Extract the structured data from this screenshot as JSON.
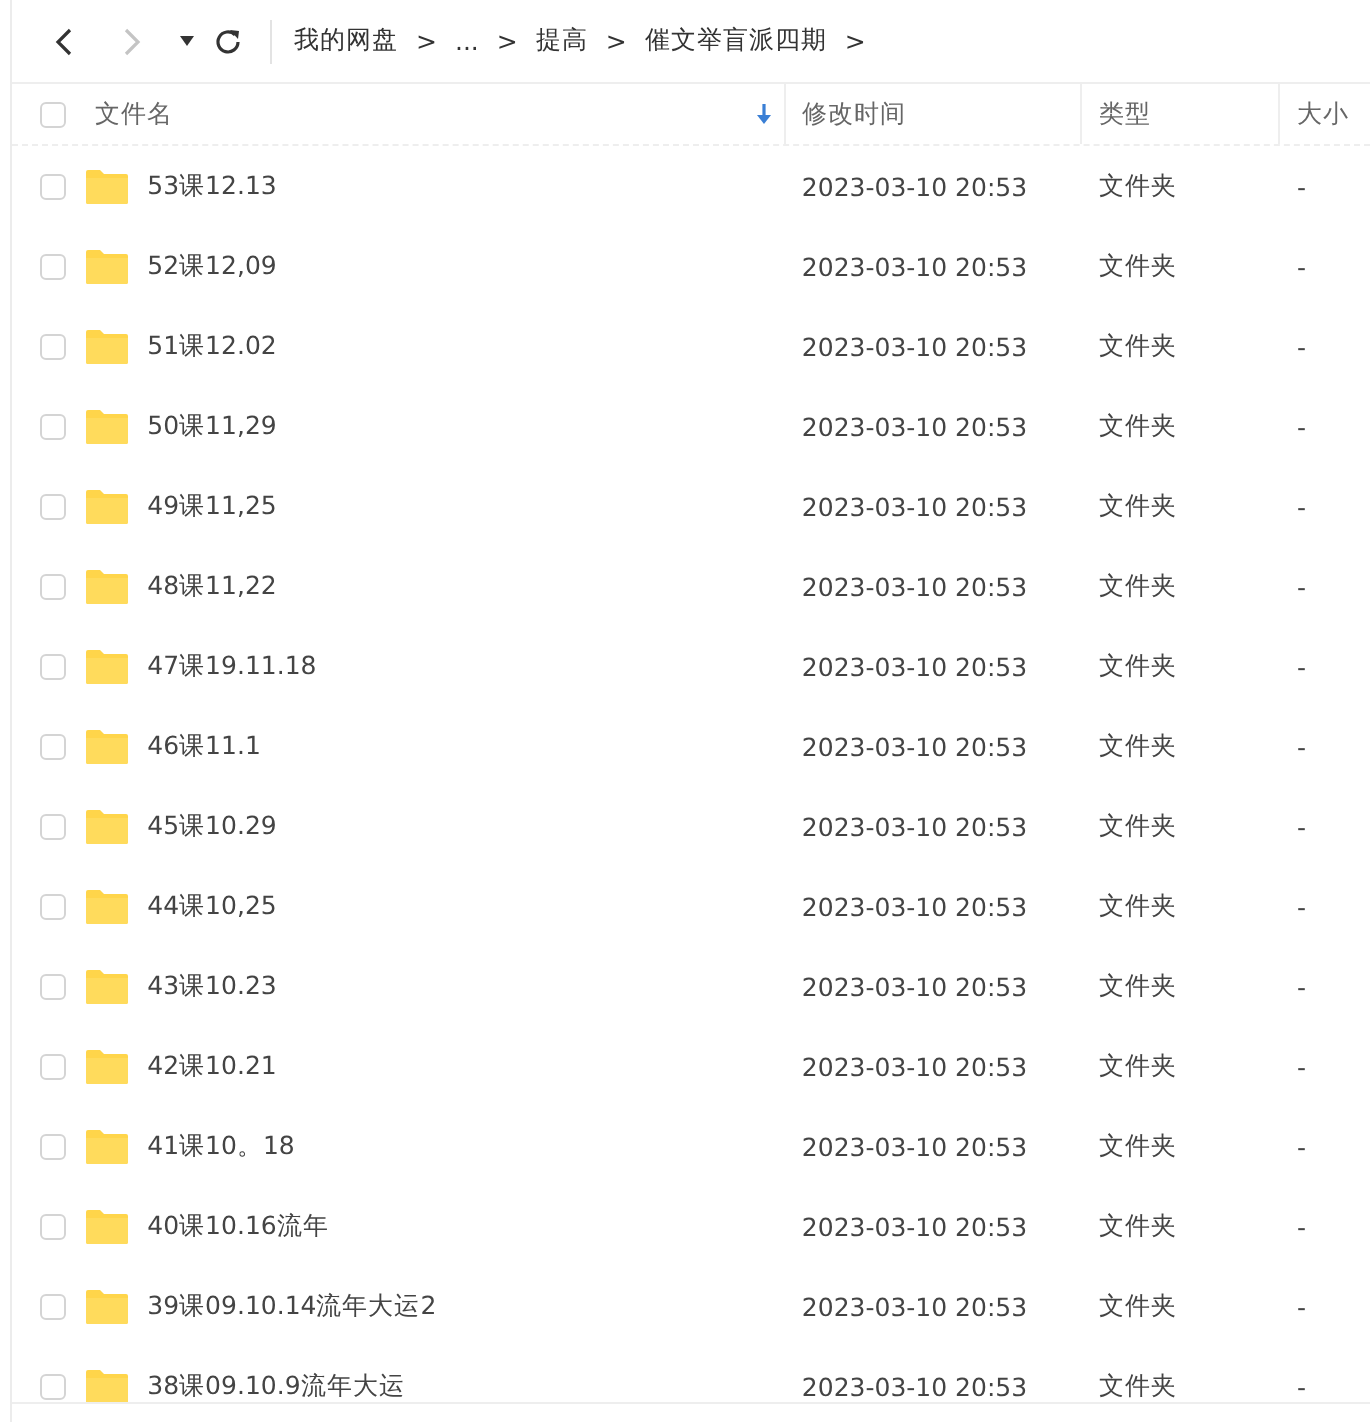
{
  "nav": {
    "back": {
      "disabled": false
    },
    "forward": {
      "disabled": true
    }
  },
  "breadcrumbs": [
    {
      "label": "我的网盘"
    },
    {
      "label": "..."
    },
    {
      "label": "提高"
    },
    {
      "label": "催文举盲派四期"
    }
  ],
  "breadcrumb_separator": ">",
  "header": {
    "checked": false,
    "columns": [
      {
        "label": "文件名",
        "sorted": true
      },
      {
        "label": "修改时间",
        "sorted": false
      },
      {
        "label": "类型",
        "sorted": false
      },
      {
        "label": "大小",
        "sorted": false
      }
    ]
  },
  "rows": [
    {
      "name": "53课12.13",
      "modified": "2023-03-10 20:53",
      "type": "文件夹",
      "size": "-",
      "checked": false
    },
    {
      "name": "52课12,09",
      "modified": "2023-03-10 20:53",
      "type": "文件夹",
      "size": "-",
      "checked": false
    },
    {
      "name": "51课12.02",
      "modified": "2023-03-10 20:53",
      "type": "文件夹",
      "size": "-",
      "checked": false
    },
    {
      "name": "50课11,29",
      "modified": "2023-03-10 20:53",
      "type": "文件夹",
      "size": "-",
      "checked": false
    },
    {
      "name": "49课11,25",
      "modified": "2023-03-10 20:53",
      "type": "文件夹",
      "size": "-",
      "checked": false
    },
    {
      "name": "48课11,22",
      "modified": "2023-03-10 20:53",
      "type": "文件夹",
      "size": "-",
      "checked": false
    },
    {
      "name": "47课19.11.18",
      "modified": "2023-03-10 20:53",
      "type": "文件夹",
      "size": "-",
      "checked": false
    },
    {
      "name": "46课11.1",
      "modified": "2023-03-10 20:53",
      "type": "文件夹",
      "size": "-",
      "checked": false
    },
    {
      "name": "45课10.29",
      "modified": "2023-03-10 20:53",
      "type": "文件夹",
      "size": "-",
      "checked": false
    },
    {
      "name": "44课10,25",
      "modified": "2023-03-10 20:53",
      "type": "文件夹",
      "size": "-",
      "checked": false
    },
    {
      "name": "43课10.23",
      "modified": "2023-03-10 20:53",
      "type": "文件夹",
      "size": "-",
      "checked": false
    },
    {
      "name": "42课10.21",
      "modified": "2023-03-10 20:53",
      "type": "文件夹",
      "size": "-",
      "checked": false
    },
    {
      "name": "41课10。18",
      "modified": "2023-03-10 20:53",
      "type": "文件夹",
      "size": "-",
      "checked": false
    },
    {
      "name": "40课10.16流年",
      "modified": "2023-03-10 20:53",
      "type": "文件夹",
      "size": "-",
      "checked": false
    },
    {
      "name": "39课09.10.14流年大运2",
      "modified": "2023-03-10 20:53",
      "type": "文件夹",
      "size": "-",
      "checked": false
    },
    {
      "name": "38课09.10.9流年大运",
      "modified": "2023-03-10 20:53",
      "type": "文件夹",
      "size": "-",
      "checked": false
    }
  ]
}
